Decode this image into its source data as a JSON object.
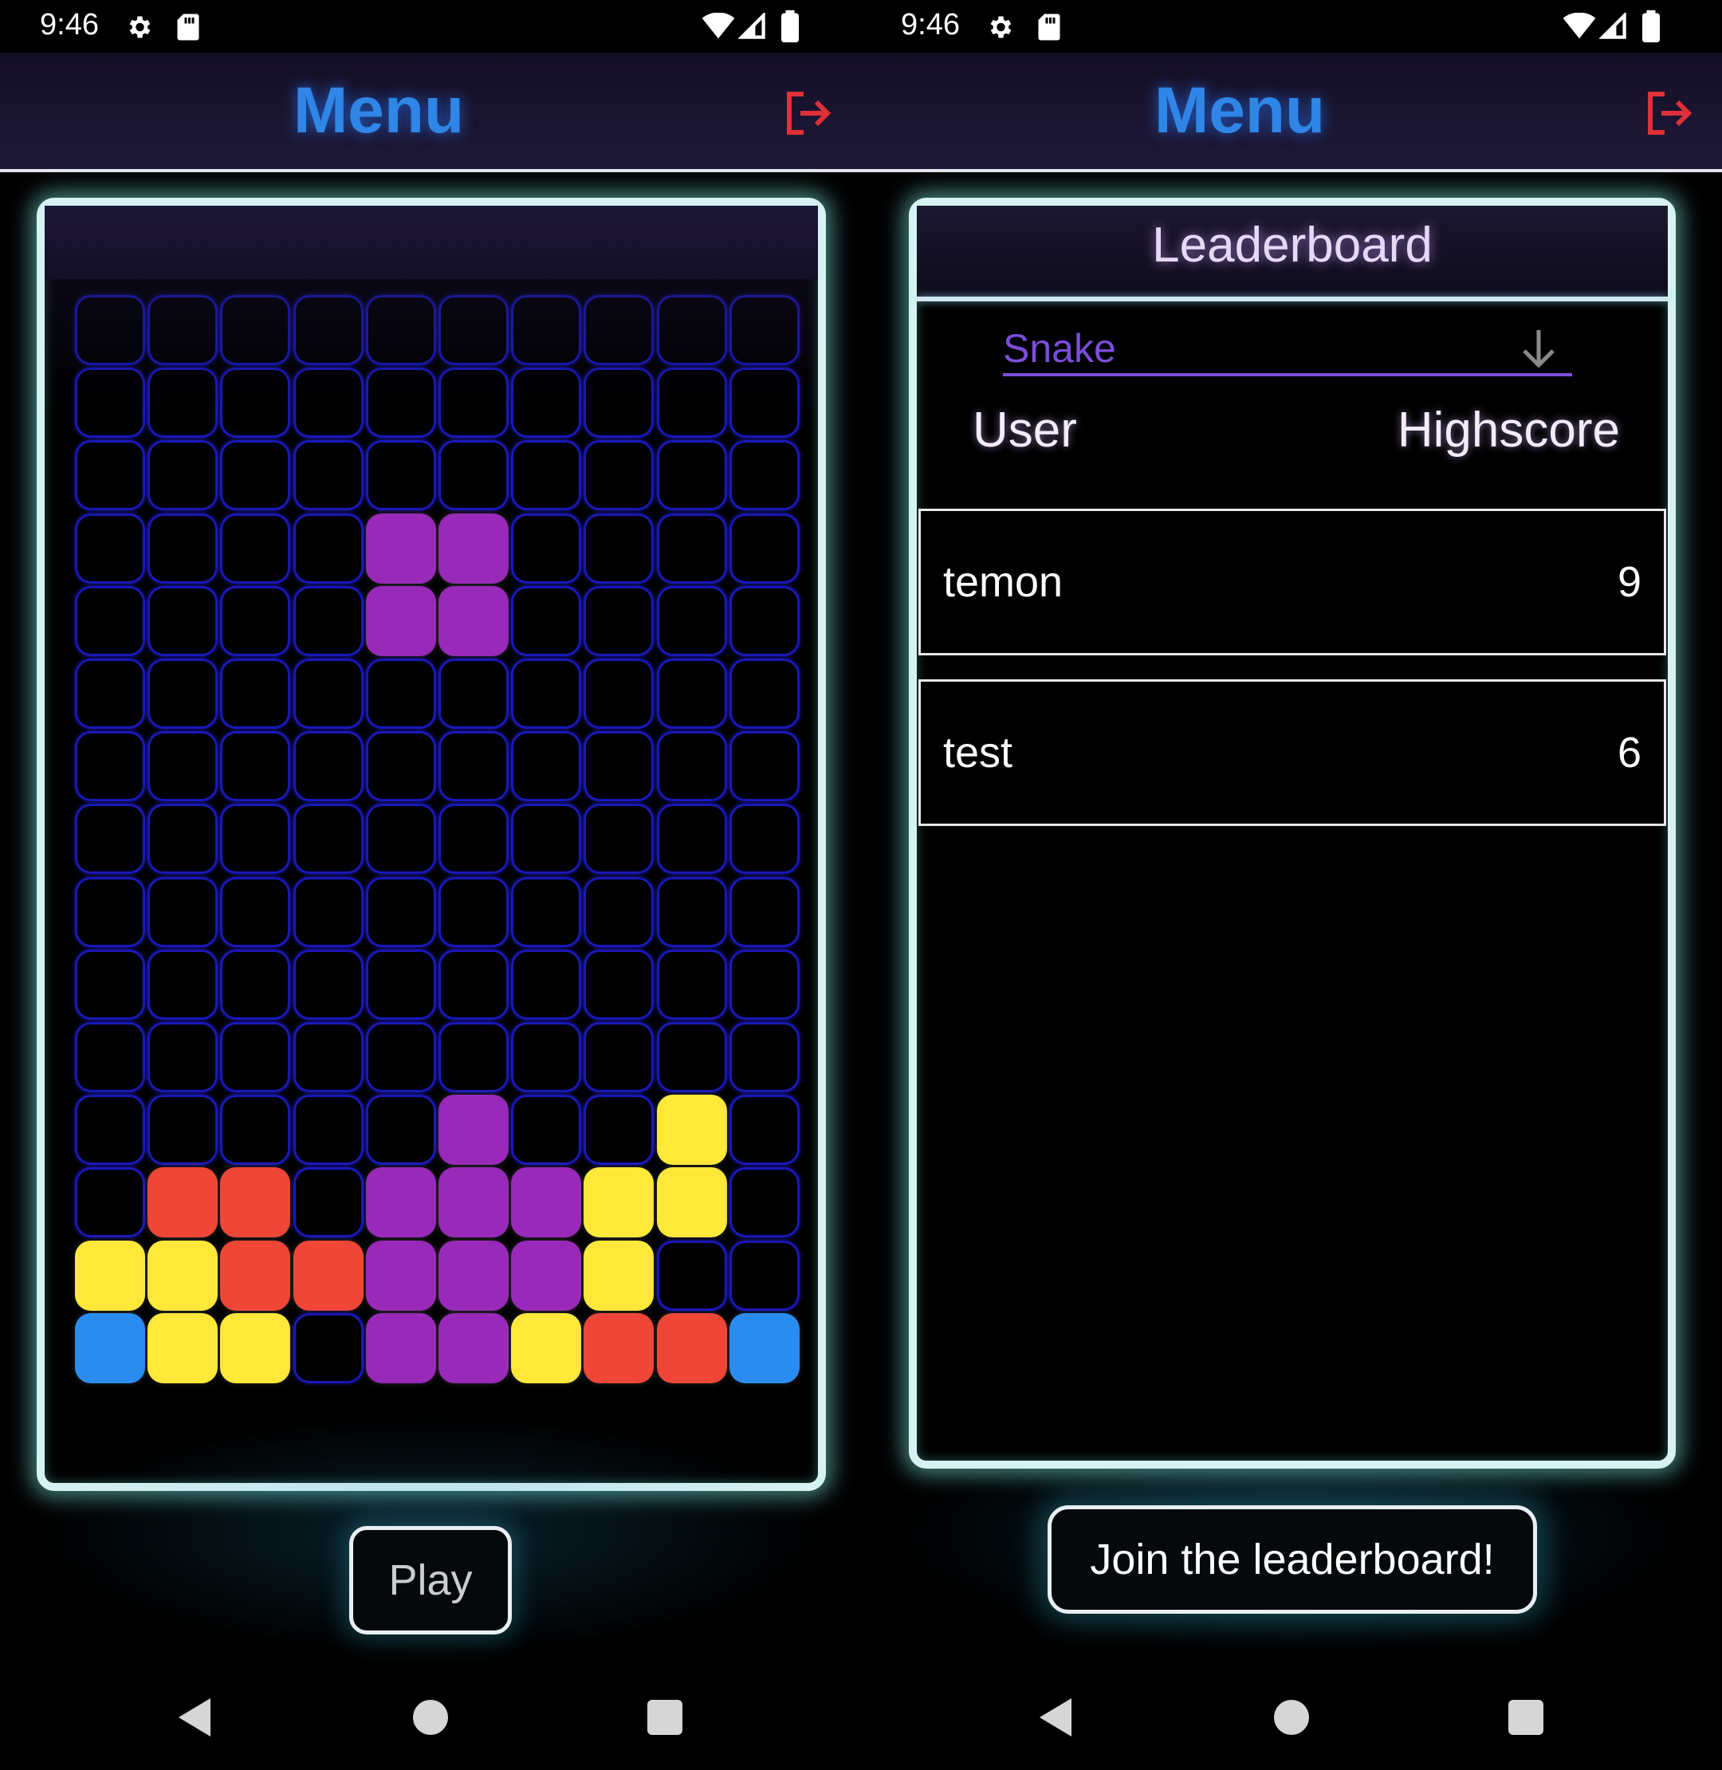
{
  "status_bar": {
    "time": "9:46"
  },
  "left": {
    "header": {
      "title": "Menu"
    },
    "game": {
      "columns": 10,
      "rows": 15,
      "colors": {
        "purple": "#9929b8",
        "red": "#ef4637",
        "yellow": "#ffe83a",
        "blue": "#2b8cf0"
      },
      "filled_cells": [
        {
          "r": 3,
          "c": 4,
          "color": "purple"
        },
        {
          "r": 3,
          "c": 5,
          "color": "purple"
        },
        {
          "r": 4,
          "c": 4,
          "color": "purple"
        },
        {
          "r": 4,
          "c": 5,
          "color": "purple"
        },
        {
          "r": 11,
          "c": 5,
          "color": "purple"
        },
        {
          "r": 11,
          "c": 8,
          "color": "yellow"
        },
        {
          "r": 12,
          "c": 1,
          "color": "red"
        },
        {
          "r": 12,
          "c": 2,
          "color": "red"
        },
        {
          "r": 12,
          "c": 4,
          "color": "purple"
        },
        {
          "r": 12,
          "c": 5,
          "color": "purple"
        },
        {
          "r": 12,
          "c": 6,
          "color": "purple"
        },
        {
          "r": 12,
          "c": 7,
          "color": "yellow"
        },
        {
          "r": 12,
          "c": 8,
          "color": "yellow"
        },
        {
          "r": 13,
          "c": 0,
          "color": "yellow"
        },
        {
          "r": 13,
          "c": 1,
          "color": "yellow"
        },
        {
          "r": 13,
          "c": 2,
          "color": "red"
        },
        {
          "r": 13,
          "c": 3,
          "color": "red"
        },
        {
          "r": 13,
          "c": 4,
          "color": "purple"
        },
        {
          "r": 13,
          "c": 5,
          "color": "purple"
        },
        {
          "r": 13,
          "c": 6,
          "color": "purple"
        },
        {
          "r": 13,
          "c": 7,
          "color": "yellow"
        },
        {
          "r": 14,
          "c": 0,
          "color": "blue"
        },
        {
          "r": 14,
          "c": 1,
          "color": "yellow"
        },
        {
          "r": 14,
          "c": 2,
          "color": "yellow"
        },
        {
          "r": 14,
          "c": 4,
          "color": "purple"
        },
        {
          "r": 14,
          "c": 5,
          "color": "purple"
        },
        {
          "r": 14,
          "c": 6,
          "color": "yellow"
        },
        {
          "r": 14,
          "c": 7,
          "color": "red"
        },
        {
          "r": 14,
          "c": 8,
          "color": "red"
        },
        {
          "r": 14,
          "c": 9,
          "color": "blue"
        }
      ]
    },
    "play_button": "Play"
  },
  "right": {
    "header": {
      "title": "Menu"
    },
    "leaderboard": {
      "title": "Leaderboard",
      "game_select": "Snake",
      "col_user": "User",
      "col_score": "Highscore",
      "rows": [
        {
          "user": "temon",
          "score": "9"
        },
        {
          "user": "test",
          "score": "6"
        }
      ]
    },
    "join_button": "Join the leaderboard!"
  },
  "icons": {
    "gear": "gear-icon",
    "sd": "sd-card-icon",
    "wifi": "wifi-icon",
    "signal": "signal-icon",
    "battery": "battery-icon",
    "logout": "logout-icon",
    "dropdown": "arrow-down-icon",
    "back": "back-icon",
    "home": "home-icon",
    "recent": "recent-apps-icon"
  },
  "accent_colors": {
    "title": "#2f86e6",
    "logout": "#e0303a",
    "select": "#7c4ddb",
    "panel_border": "#d6f2f2"
  }
}
